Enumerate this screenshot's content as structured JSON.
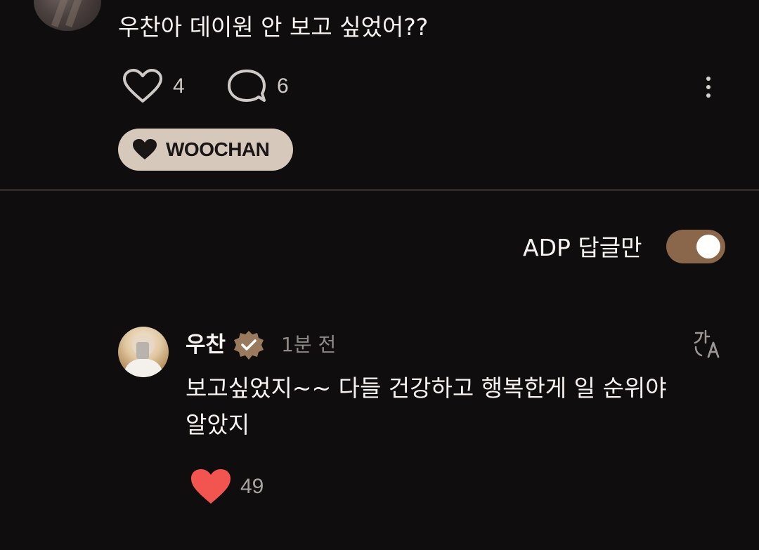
{
  "post": {
    "text": "우찬아 데이원 안 보고 싶었어??",
    "like_count": "4",
    "comment_count": "6",
    "member_tag": "WOOCHAN"
  },
  "filter": {
    "label": "ADP 답글만",
    "toggle_on": true
  },
  "comment": {
    "author": "우찬",
    "time": "1분 전",
    "text": "보고싶었지~~ 다들 건강하고 행복한게 일 순위야 알았지",
    "like_count": "49",
    "liked": true
  },
  "colors": {
    "background": "#0f0d0d",
    "tag_bg": "#d7c8bc",
    "toggle_on": "#8a664a",
    "badge": "#9a7a5e",
    "like_red": "#f2554f"
  },
  "icons": [
    "heart-outline-icon",
    "comment-bubble-icon",
    "more-vertical-icon",
    "heart-filled-icon",
    "verified-badge-icon",
    "translate-icon"
  ]
}
